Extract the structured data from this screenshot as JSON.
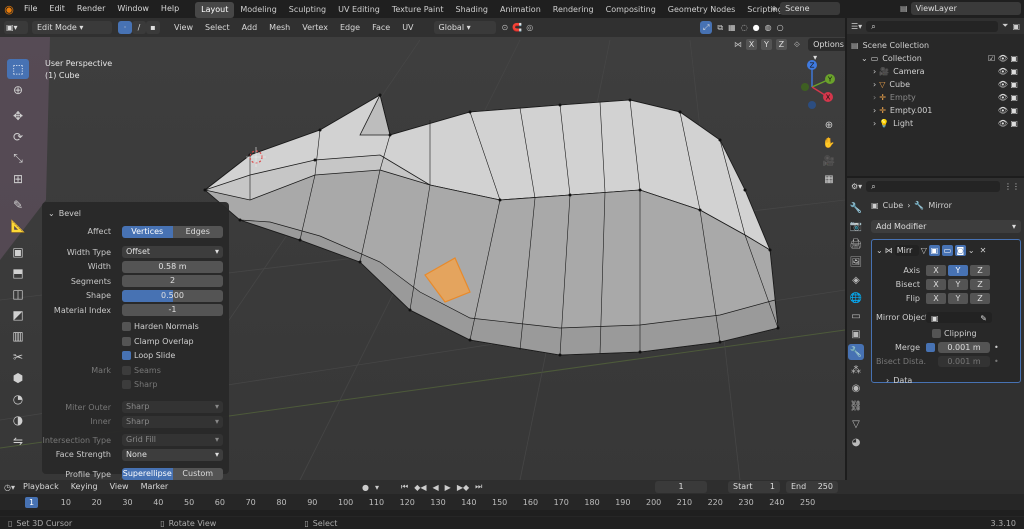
{
  "menu": [
    "File",
    "Edit",
    "Render",
    "Window",
    "Help"
  ],
  "workspaces": [
    "Layout",
    "Modeling",
    "Sculpting",
    "UV Editing",
    "Texture Paint",
    "Shading",
    "Animation",
    "Rendering",
    "Compositing",
    "Geometry Nodes",
    "Scripting"
  ],
  "add_ws": "+",
  "scene": "Scene",
  "view_layer": "ViewLayer",
  "header": {
    "mode": "Edit Mode",
    "items": [
      "View",
      "Select",
      "Add",
      "Mesh",
      "Vertex",
      "Edge",
      "Face",
      "UV"
    ],
    "orientation": "Global",
    "options": "Options",
    "axes": [
      "X",
      "Y",
      "Z"
    ]
  },
  "viewport": {
    "line1": "User Perspective",
    "line2": "(1) Cube",
    "gizmo": {
      "z": "Z",
      "y": "Y",
      "x": "X"
    }
  },
  "bevel": {
    "title": "Bevel",
    "affect_label": "Affect",
    "affect_opts": [
      "Vertices",
      "Edges"
    ],
    "width_type_label": "Width Type",
    "width_type": "Offset",
    "width_label": "Width",
    "width": "0.58 m",
    "segments_label": "Segments",
    "segments": "2",
    "shape_label": "Shape",
    "shape": "0.500",
    "shape_fraction": 0.5,
    "material_label": "Material Index",
    "material": "-1",
    "harden": "Harden Normals",
    "clamp": "Clamp Overlap",
    "loop": "Loop Slide",
    "mark_label": "Mark",
    "seams": "Seams",
    "sharp": "Sharp",
    "miter_outer_label": "Miter Outer",
    "miter_outer": "Sharp",
    "inner_label": "Inner",
    "inner": "Sharp",
    "intersection_label": "Intersection Type",
    "intersection": "Grid Fill",
    "face_strength_label": "Face Strength",
    "face_strength": "None",
    "profile_label": "Profile Type",
    "profile_opts": [
      "Superellipse",
      "Custom"
    ]
  },
  "outliner": {
    "root": "Scene Collection",
    "collection": "Collection",
    "items": [
      {
        "name": "Camera",
        "dim": false
      },
      {
        "name": "Cube",
        "dim": false
      },
      {
        "name": "Empty",
        "dim": true
      },
      {
        "name": "Empty.001",
        "dim": false
      },
      {
        "name": "Light",
        "dim": false
      }
    ]
  },
  "props": {
    "object": "Cube",
    "modifier": "Mirror",
    "add_modifier": "Add Modifier",
    "mod_name": "Mirr",
    "axis_label": "Axis",
    "bisect_label": "Bisect",
    "flip_label": "Flip",
    "axes": [
      "X",
      "Y",
      "Z"
    ],
    "mirror_object_label": "Mirror Object",
    "clipping": "Clipping",
    "merge_label": "Merge",
    "merge": "0.001 m",
    "bisect_dist_label": "Bisect Dista...",
    "bisect_dist": "0.001 m",
    "data": "Data"
  },
  "timeline": {
    "menus": [
      "Playback",
      "Keying",
      "View",
      "Marker"
    ],
    "current": "1",
    "start_label": "Start",
    "start": "1",
    "end_label": "End",
    "end": "250",
    "ticks": [
      "1",
      "10",
      "20",
      "30",
      "40",
      "50",
      "60",
      "70",
      "80",
      "90",
      "100",
      "110",
      "120",
      "130",
      "140",
      "150",
      "160",
      "170",
      "180",
      "190",
      "200",
      "210",
      "220",
      "230",
      "240",
      "250"
    ]
  },
  "status": {
    "a": "Set 3D Cursor",
    "b": "Rotate View",
    "c": "Select",
    "version": "3.3.10"
  },
  "colors": {
    "accent": "#4772b3",
    "mesh": "#c8c8c8",
    "selected": "#e88a2b"
  }
}
